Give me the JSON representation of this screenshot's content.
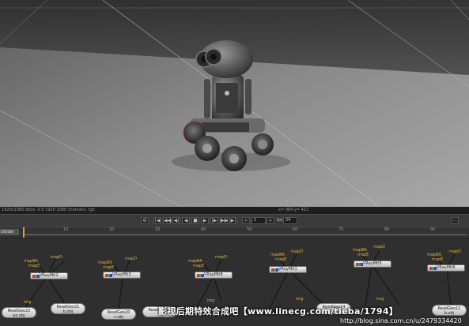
{
  "viewer": {
    "info_left": "1920x1080 bbox: 0 0 1920 1080 channels: rgb",
    "info_right": "x= 984 y= 421"
  },
  "transport": {
    "frame": "1",
    "fps_label": "fps",
    "fps_value": "24"
  },
  "timeline": {
    "selector": "Global",
    "ticks": [
      "10",
      "20",
      "30",
      "40",
      "50",
      "60",
      "70",
      "80",
      "90"
    ],
    "current_frame": 1
  },
  "nodegraph": {
    "ray_nodes": [
      "VRayMtl2",
      "VRayMtl3",
      "VRayMtl8",
      "VRayMtl1",
      "VRayMtl5",
      "VRayMtl6"
    ],
    "input_labels": [
      "mapD",
      "mapBA",
      "mapE",
      "img"
    ],
    "read_nodes": [
      {
        "line1": "ReadGeo22",
        "line2": "es.obj"
      },
      {
        "line1": "ReadGeo21",
        "line2": "b.obj"
      },
      {
        "line1": "ReadGeo20",
        "line2": "c.obj"
      },
      {
        "line1": "ReadGeo15",
        "line2": ""
      },
      {
        "line1": "ReadGeo14",
        "line2": ""
      },
      {
        "line1": "ReadGeo12",
        "line2": "b.obj"
      }
    ]
  },
  "overlay": {
    "watermark": "影视后期特效合成吧【www.linecg.com/tieba/1794】",
    "url": "http://blog.sina.com.cn/u/2479334420"
  },
  "colors": {
    "accent": "#e0a020",
    "input_label": "#e0b040"
  }
}
